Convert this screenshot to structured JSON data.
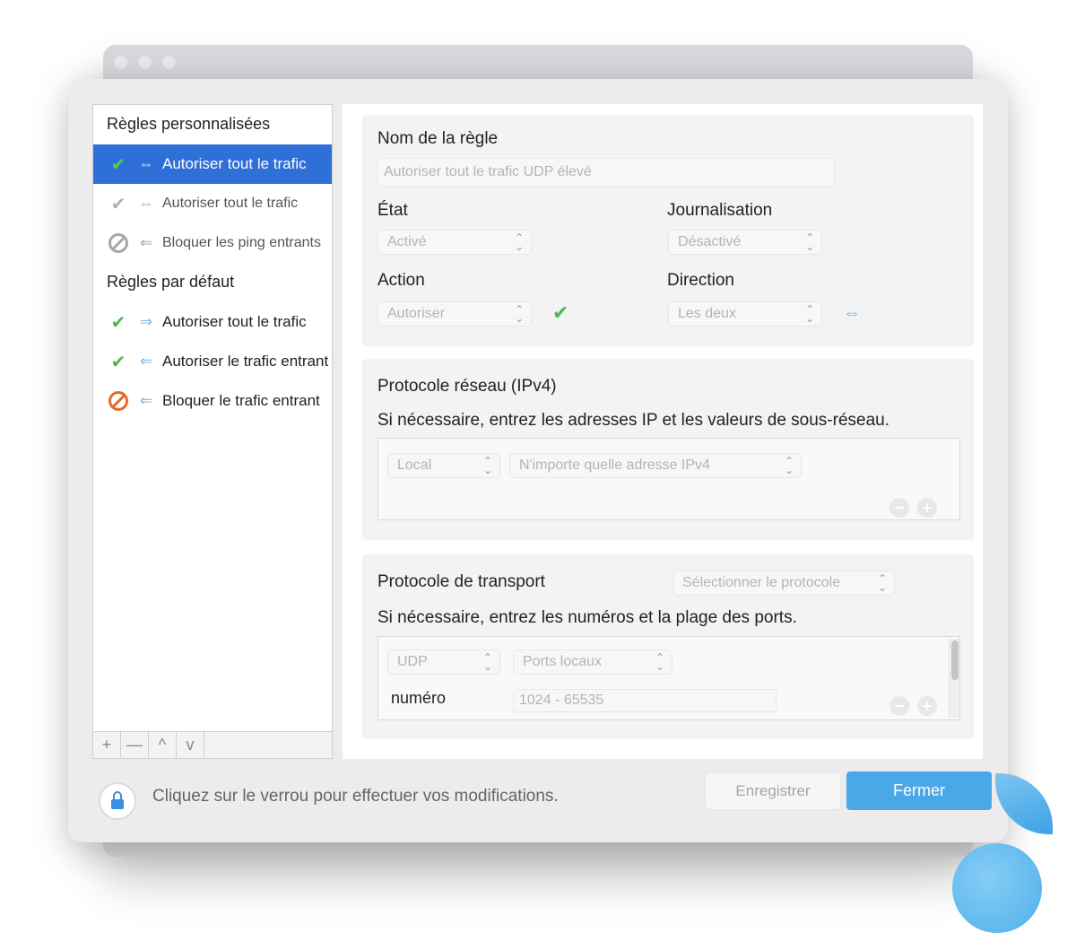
{
  "sidebar": {
    "custom_header": "Règles personnalisées",
    "custom_items": [
      {
        "label": "Autoriser tout le trafic",
        "status_icon": "checkmark-icon",
        "direction_icon": "bidirectional-arrow-icon",
        "selected": true
      },
      {
        "label": "Autoriser tout le trafic",
        "status_icon": "checkmark-icon",
        "direction_icon": "bidirectional-arrow-icon",
        "selected": false
      },
      {
        "label": "Bloquer les ping entrants",
        "status_icon": "block-icon",
        "direction_icon": "incoming-arrow-icon",
        "selected": false
      }
    ],
    "default_header": "Règles par défaut",
    "default_items": [
      {
        "label": "Autoriser tout le trafic",
        "status_icon": "checkmark-icon",
        "direction_icon": "outgoing-arrow-icon"
      },
      {
        "label": "Autoriser le trafic entrant",
        "status_icon": "checkmark-icon",
        "direction_icon": "incoming-arrow-icon"
      },
      {
        "label": "Bloquer le trafic entrant",
        "status_icon": "block-icon",
        "direction_icon": "incoming-arrow-icon"
      }
    ],
    "toolbar": {
      "add": "+",
      "remove": "—",
      "up": "^",
      "down": "v"
    }
  },
  "rule": {
    "name_label": "Nom de la règle",
    "name_value": "Autoriser tout le trafic UDP élevé",
    "state_label": "État",
    "state_value": "Activé",
    "logging_label": "Journalisation",
    "logging_value": "Désactivé",
    "action_label": "Action",
    "action_value": "Autoriser",
    "direction_label": "Direction",
    "direction_value": "Les deux"
  },
  "network": {
    "title": "Protocole réseau (IPv4)",
    "hint": "Si nécessaire, entrez les adresses IP et les valeurs de sous-réseau.",
    "scope_value": "Local",
    "address_value": "N'importe quelle adresse IPv4"
  },
  "transport": {
    "title": "Protocole de transport",
    "protocol_select": "Sélectionner le protocole",
    "hint": "Si nécessaire, entrez les numéros et la plage des ports.",
    "proto_value": "UDP",
    "ports_value": "Ports locaux",
    "number_label": "numéro",
    "range_value": "1024 - 65535"
  },
  "footer": {
    "lock_hint": "Cliquez sur le verrou pour effectuer vos modifications.",
    "save_label": "Enregistrer",
    "close_label": "Fermer"
  },
  "colors": {
    "selection": "#2f6fd8",
    "primary_button": "#4aa8e9",
    "allow": "#4cb84c",
    "block": "#e46a2c"
  }
}
